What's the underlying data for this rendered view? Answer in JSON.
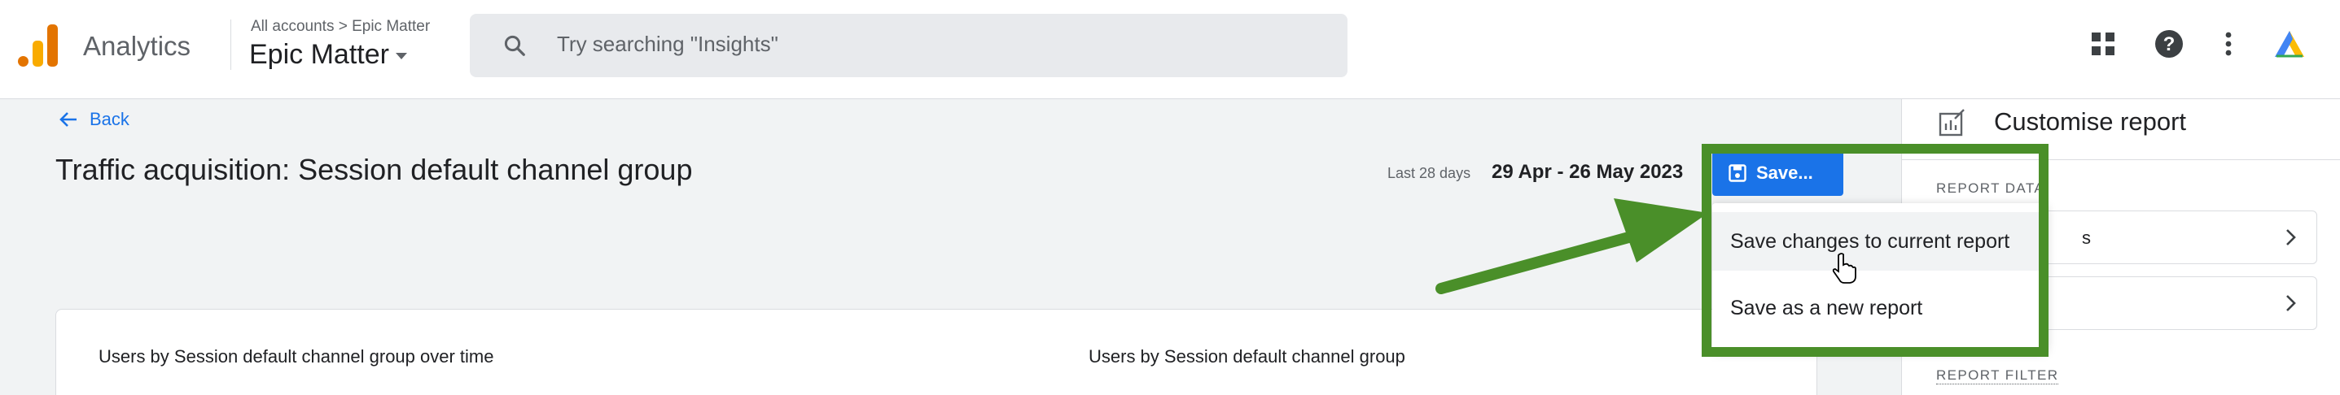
{
  "header": {
    "app_name": "Analytics",
    "breadcrumb": "All accounts > Epic Matter",
    "account_name": "Epic Matter",
    "search_placeholder": "Try searching \"Insights\""
  },
  "page": {
    "back_label": "Back",
    "title": "Traffic acquisition: Session default channel group",
    "date_label": "Last 28 days",
    "date_range": "29 Apr - 26 May 2023",
    "save_label": "Save..."
  },
  "card": {
    "chart_title_left": "Users by Session default channel group over time",
    "chart_title_right": "Users by Session default channel group"
  },
  "save_menu": {
    "items": [
      "Save changes to current report",
      "Save as a new report"
    ]
  },
  "panel": {
    "title": "Customise report",
    "section_data": "REPORT DATA",
    "row_1_text": "s",
    "section_filter": "REPORT FILTER"
  },
  "colors": {
    "accent": "#1a73e8",
    "annotation_green": "#4a8f29"
  }
}
